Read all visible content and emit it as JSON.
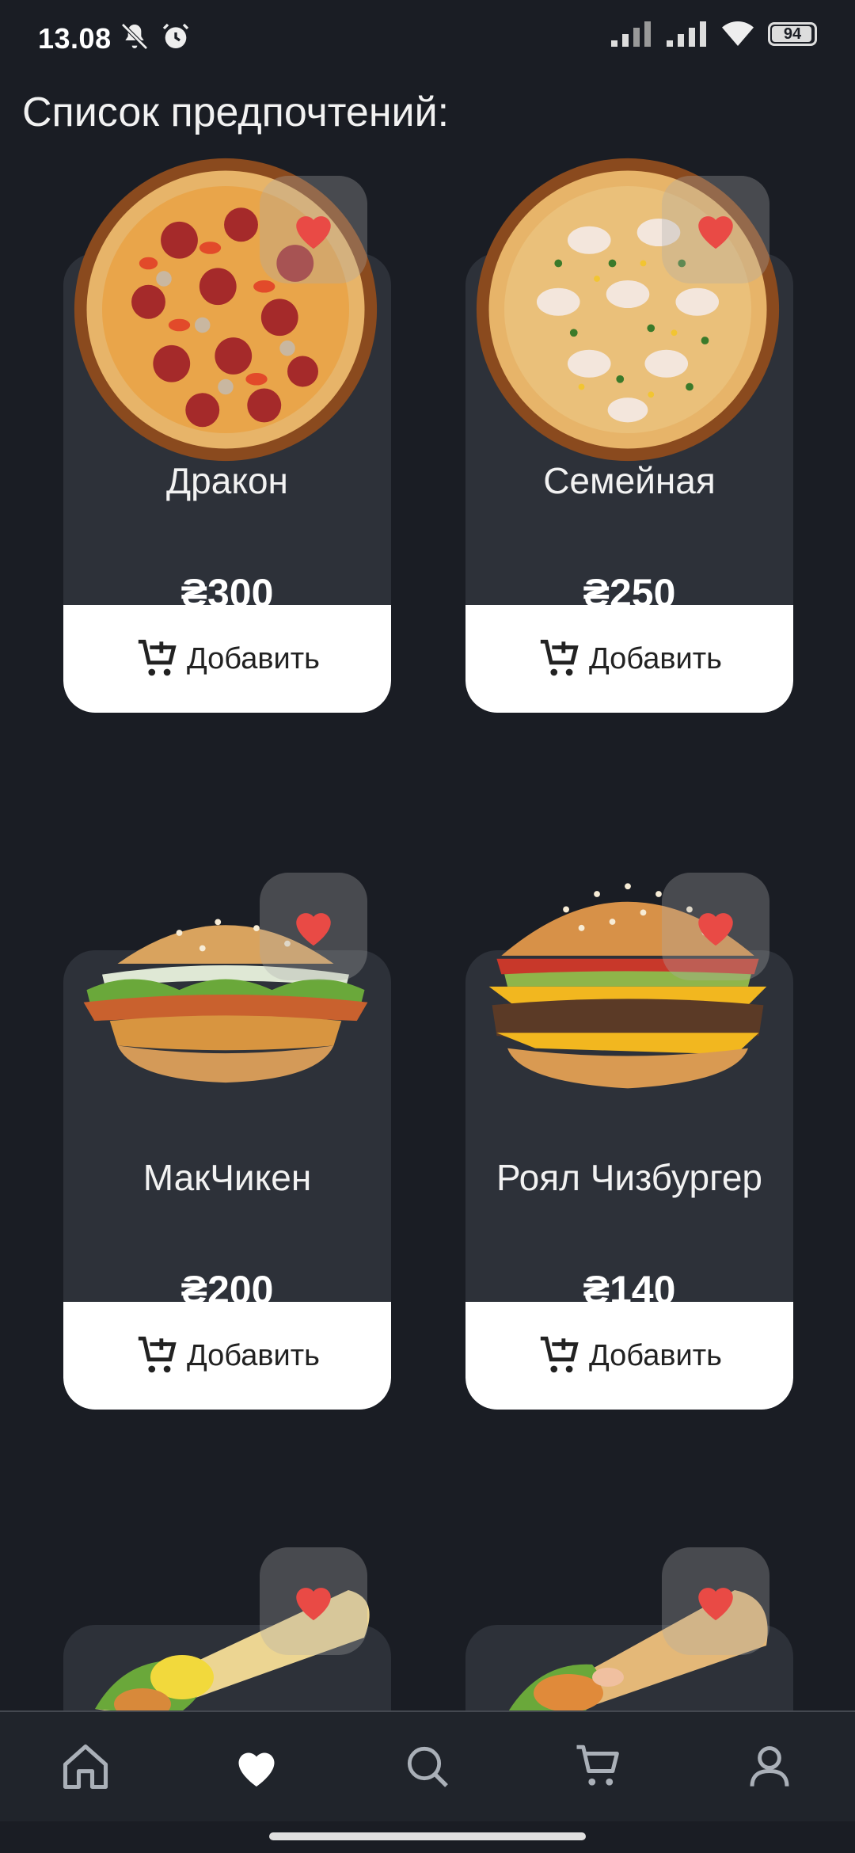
{
  "status": {
    "time": "13.08",
    "battery": "94"
  },
  "page": {
    "title": "Список предпочтений:"
  },
  "products": [
    {
      "name": "Дракон",
      "price": "₴300",
      "add_label": "Добавить",
      "image": "pizza-pepperoni"
    },
    {
      "name": "Семейная",
      "price": "₴250",
      "add_label": "Добавить",
      "image": "pizza-family"
    },
    {
      "name": "МакЧикен",
      "price": "₴200",
      "add_label": "Добавить",
      "image": "chicken-burger"
    },
    {
      "name": "Роял Чизбургер",
      "price": "₴140",
      "add_label": "Добавить",
      "image": "cheeseburger"
    },
    {
      "name": "",
      "price": "",
      "add_label": "",
      "image": "wrap"
    },
    {
      "name": "",
      "price": "",
      "add_label": "",
      "image": "wrap"
    }
  ],
  "nav": {
    "items": [
      "home-icon",
      "heart-icon",
      "search-icon",
      "cart-icon",
      "profile-icon"
    ],
    "active": "heart-icon"
  },
  "colors": {
    "background": "#1a1d24",
    "card": "#2d3139",
    "button": "#ffffff",
    "heart": "#e94a45"
  }
}
